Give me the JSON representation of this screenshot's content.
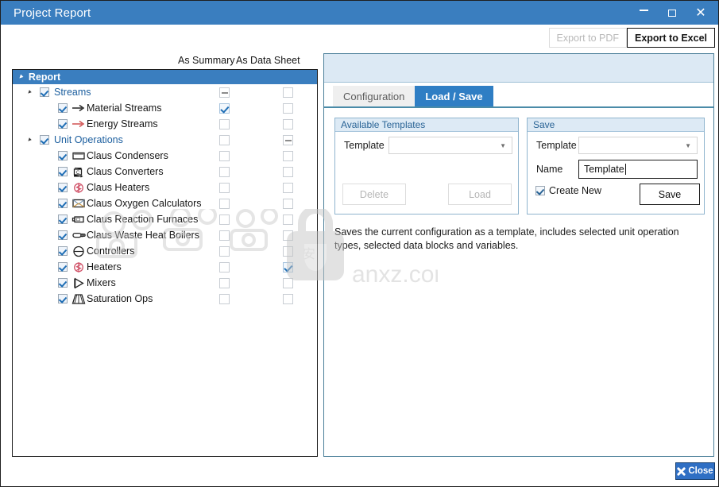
{
  "window": {
    "title": "Project Report",
    "controls": {
      "minimize": "minimize-icon",
      "maximize": "maximize-icon",
      "close": "close-icon"
    }
  },
  "toolbar": {
    "export_pdf_label": "Export to PDF",
    "export_pdf_enabled": false,
    "export_excel_label": "Export to Excel",
    "export_excel_enabled": true
  },
  "tree": {
    "column_headers": {
      "summary": "As Summary",
      "data_sheet": "As Data Sheet"
    },
    "root_label": "Report",
    "rows": [
      {
        "label": "Streams",
        "level": 1,
        "parent": true,
        "icon": null,
        "row_check": "checked",
        "summary": "indeterminate",
        "sheet": "empty"
      },
      {
        "label": "Material Streams",
        "level": 2,
        "parent": false,
        "icon": "material-stream-arrow-icon",
        "row_check": "checked",
        "summary": "checked",
        "sheet": "empty"
      },
      {
        "label": "Energy Streams",
        "level": 2,
        "parent": false,
        "icon": "energy-stream-arrow-icon",
        "row_check": "checked",
        "summary": "empty",
        "sheet": "empty"
      },
      {
        "label": "Unit Operations",
        "level": 1,
        "parent": true,
        "icon": null,
        "row_check": "checked",
        "summary": "empty",
        "sheet": "indeterminate"
      },
      {
        "label": "Claus Condensers",
        "level": 2,
        "parent": false,
        "icon": "condenser-icon",
        "row_check": "checked",
        "summary": "empty",
        "sheet": "empty"
      },
      {
        "label": "Claus Converters",
        "level": 2,
        "parent": false,
        "icon": "converter-icon",
        "row_check": "checked",
        "summary": "empty",
        "sheet": "empty"
      },
      {
        "label": "Claus Heaters",
        "level": 2,
        "parent": false,
        "icon": "heater-icon",
        "row_check": "checked",
        "summary": "empty",
        "sheet": "empty"
      },
      {
        "label": "Claus Oxygen Calculators",
        "level": 2,
        "parent": false,
        "icon": "oxygen-calculator-icon",
        "row_check": "checked",
        "summary": "empty",
        "sheet": "empty"
      },
      {
        "label": "Claus Reaction Furnaces",
        "level": 2,
        "parent": false,
        "icon": "reaction-furnace-icon",
        "row_check": "checked",
        "summary": "empty",
        "sheet": "empty"
      },
      {
        "label": "Claus Waste Heat Boilers",
        "level": 2,
        "parent": false,
        "icon": "waste-heat-boiler-icon",
        "row_check": "checked",
        "summary": "empty",
        "sheet": "empty"
      },
      {
        "label": "Controllers",
        "level": 2,
        "parent": false,
        "icon": "controller-icon",
        "row_check": "checked",
        "summary": "empty",
        "sheet": "empty"
      },
      {
        "label": "Heaters",
        "level": 2,
        "parent": false,
        "icon": "heater-icon",
        "row_check": "checked",
        "summary": "empty",
        "sheet": "checked"
      },
      {
        "label": "Mixers",
        "level": 2,
        "parent": false,
        "icon": "mixer-icon",
        "row_check": "checked",
        "summary": "empty",
        "sheet": "empty"
      },
      {
        "label": "Saturation Ops",
        "level": 2,
        "parent": false,
        "icon": "saturation-op-icon",
        "row_check": "checked",
        "summary": "empty",
        "sheet": "empty"
      }
    ]
  },
  "right_panel": {
    "tabs": [
      {
        "label": "Configuration",
        "active": false
      },
      {
        "label": "Load / Save",
        "active": true
      }
    ],
    "available_templates": {
      "title": "Available Templates",
      "template_label": "Template",
      "template_value": "",
      "delete_label": "Delete",
      "delete_enabled": false,
      "load_label": "Load",
      "load_enabled": false
    },
    "save": {
      "title": "Save",
      "template_label": "Template",
      "template_value": "",
      "name_label": "Name",
      "name_value": "Template",
      "create_new_label": "Create New",
      "create_new_checked": true,
      "save_label": "Save",
      "save_enabled": true
    },
    "description": "Saves the current configuration as a template, includes selected unit operation types, selected data blocks and variables."
  },
  "footer": {
    "close_label": "Close"
  },
  "watermark": {
    "text": "anxz.com"
  },
  "colors": {
    "title_bar": "#3a7ebf",
    "tree_header": "#3a7ebf",
    "active_tab": "#2f7ec4",
    "group_header": "#ddeaf5",
    "close_button": "#2f6fc4",
    "energy_stream": "#d05050",
    "parent_label": "#1b5e9e"
  }
}
